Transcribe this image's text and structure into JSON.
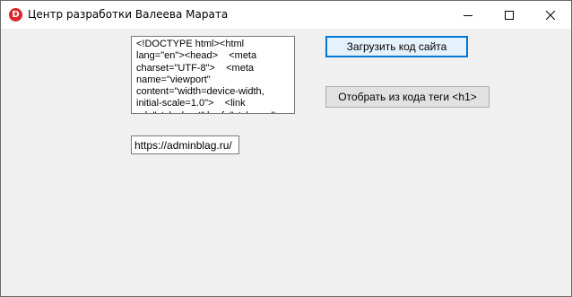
{
  "window": {
    "title": "Центр разработки Валеева Марата",
    "app_icon_letter": "D",
    "app_icon_color": "#d9272e",
    "accent_color": "#0078d7"
  },
  "code_box": {
    "value": "<!DOCTYPE html><html lang=\"en\"><head>    <meta charset=\"UTF-8\">    <meta name=\"viewport\" content=\"width=device-width, initial-scale=1.0\">    <link rel=\"stylesheet\" href=\"style.css\">"
  },
  "buttons": {
    "load_label": "Загрузить код сайта",
    "h1_label": "Отобрать из кода теги <h1>"
  },
  "url_field": {
    "value": "https://adminblag.ru/"
  },
  "icons": {
    "minimize": "minimize-icon",
    "maximize": "maximize-icon",
    "close": "close-icon"
  }
}
